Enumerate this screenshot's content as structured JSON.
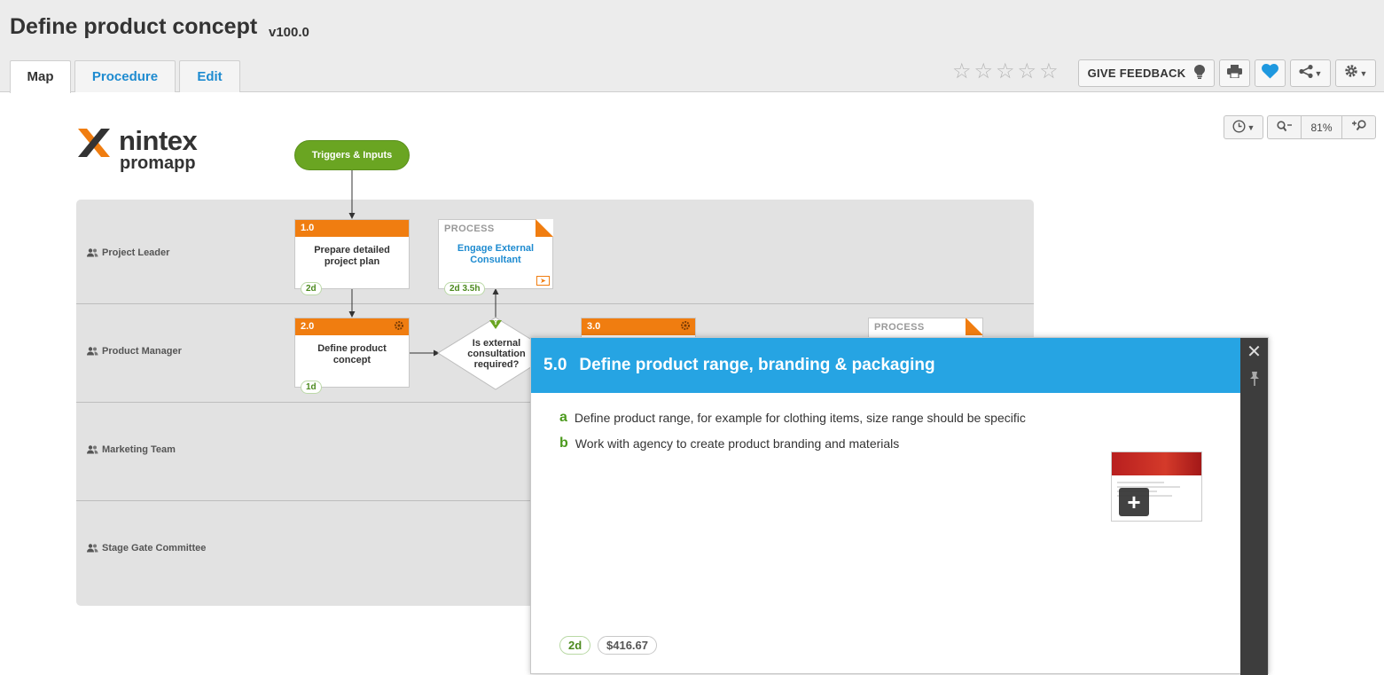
{
  "header": {
    "title": "Define product concept",
    "version": "v100.0",
    "tabs": [
      {
        "label": "Map",
        "active": true
      },
      {
        "label": "Procedure",
        "active": false
      },
      {
        "label": "Edit",
        "active": false
      }
    ],
    "rating": {
      "value": 0,
      "max": 5
    },
    "feedback_label": "GIVE FEEDBACK",
    "accent_color": "#1e8bd0"
  },
  "map_controls": {
    "zoom_level": "81%"
  },
  "logo": {
    "line1": "nintex",
    "line2": "promapp"
  },
  "map": {
    "trigger_label": "Triggers & Inputs",
    "lanes": [
      {
        "label": "Project Leader"
      },
      {
        "label": "Product Manager"
      },
      {
        "label": "Marketing Team"
      },
      {
        "label": "Stage Gate Committee"
      }
    ],
    "activities": [
      {
        "number": "1.0",
        "name": "Prepare detailed project plan",
        "time": "2d"
      },
      {
        "number": "2.0",
        "name": "Define product concept",
        "time": "1d"
      },
      {
        "number": "3.0"
      }
    ],
    "processes": [
      {
        "label": "PROCESS",
        "name": "Engage External Consultant",
        "time": "2d 3.5h"
      },
      {
        "label": "PROCESS"
      }
    ],
    "decision": {
      "text": "Is external consultation required?",
      "yes_label": "Y"
    },
    "colors": {
      "activity": "#f07d10",
      "trigger": "#6aa522",
      "lane_bg": "#e2e2e2"
    }
  },
  "popup": {
    "number": "5.0",
    "title": "Define product range, branding & packaging",
    "steps": [
      {
        "letter": "a",
        "text": "Define product range, for example for clothing items, size range should be specific"
      },
      {
        "letter": "b",
        "text": "Work with agency to create product branding and materials"
      }
    ],
    "time": "2d",
    "cost": "$416.67",
    "header_color": "#26a4e3"
  }
}
